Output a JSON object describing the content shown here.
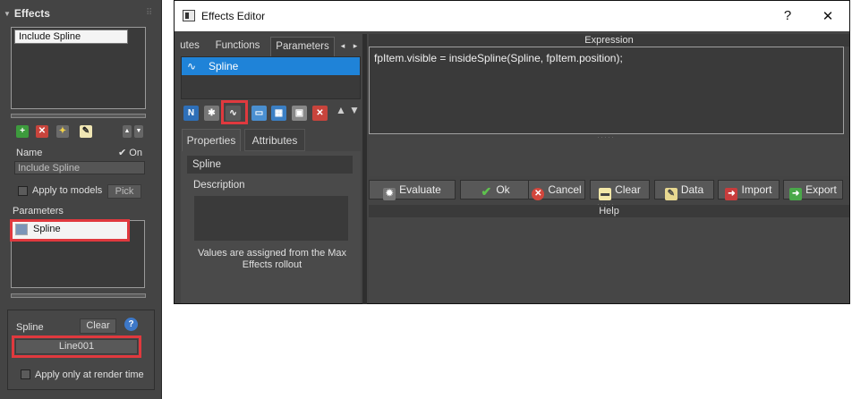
{
  "left_panel": {
    "title": "Effects",
    "effects_list": [
      "Include Spline"
    ],
    "name_label": "Name",
    "on_label": "On",
    "name_value": "Include Spline",
    "apply_to_models_label": "Apply to models",
    "pick_label": "Pick",
    "parameters_label": "Parameters",
    "parameters_items": [
      "Spline"
    ],
    "spline_label": "Spline",
    "clear_label": "Clear",
    "spline_value": "Line001",
    "render_time_label": "Apply only at render time"
  },
  "editor": {
    "title": "Effects Editor",
    "help_btn": "?",
    "close_btn": "✕",
    "tabs": [
      {
        "label": "utes"
      },
      {
        "label": "Functions"
      },
      {
        "label": "Parameters"
      }
    ],
    "tab_scroll_left": "◂",
    "tab_scroll_right": "▸",
    "param_list": [
      "Spline"
    ],
    "move_up": "▲",
    "move_down": "▼",
    "prop_tabs": [
      "Properties",
      "Attributes"
    ],
    "prop_name": "Spline",
    "description_label": "Description",
    "info_text": "Values are assigned from the Max Effects rollout",
    "expression_header": "Expression",
    "expression_text": "fpItem.visible = insideSpline(Spline, fpItem.position);",
    "buttons": [
      {
        "label": "Evaluate",
        "icon": "gear-icon"
      },
      {
        "label": "Ok",
        "icon": "checkmark-icon"
      },
      {
        "label": "Cancel",
        "icon": "cancel-icon"
      },
      {
        "label": "Clear",
        "icon": "clear-icon"
      },
      {
        "label": "Data",
        "icon": "data-icon"
      },
      {
        "label": "Import",
        "icon": "import-icon"
      },
      {
        "label": "Export",
        "icon": "export-icon"
      }
    ],
    "help_header": "Help"
  },
  "colors": {
    "panel_bg": "#444444",
    "selection_blue": "#1f83d8",
    "highlight_red": "#e0393e"
  }
}
